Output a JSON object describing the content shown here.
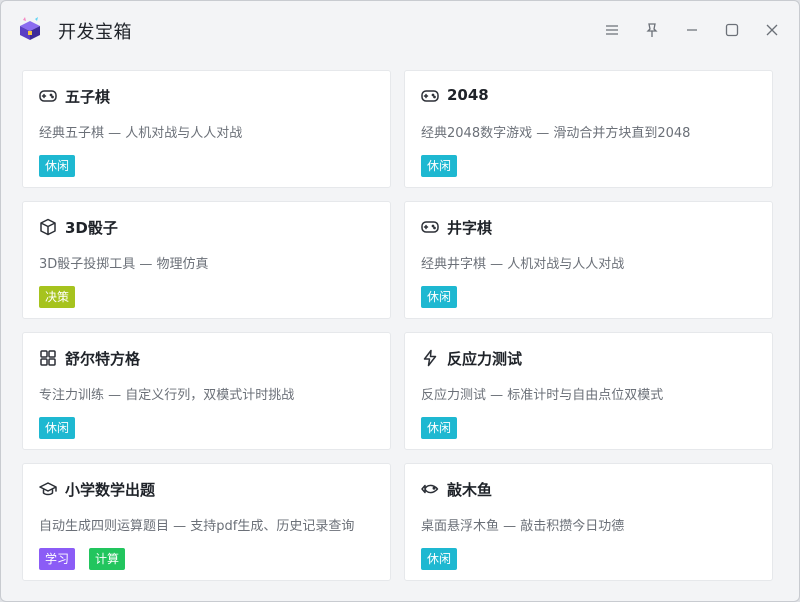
{
  "window": {
    "title": "开发宝箱",
    "logo": "treasure-chest-logo",
    "controls": [
      "menu-icon",
      "pin-icon",
      "minimize-icon",
      "maximize-icon",
      "close-icon"
    ]
  },
  "colors": {
    "tag_casual": "#1eb8d1",
    "tag_decision": "#a6c31e",
    "tag_study": "#8b5cf6",
    "tag_calc": "#22c55e"
  },
  "cards": [
    {
      "icon": "gamepad-icon",
      "title": "五子棋",
      "desc": "经典五子棋 — 人机对战与人人对战",
      "tags": [
        {
          "label": "休闲",
          "color": "#1eb8d1"
        }
      ]
    },
    {
      "icon": "gamepad-icon",
      "title": "2048",
      "desc": "经典2048数字游戏 — 滑动合并方块直到2048",
      "tags": [
        {
          "label": "休闲",
          "color": "#1eb8d1"
        }
      ]
    },
    {
      "icon": "cube-icon",
      "title": "3D骰子",
      "desc": "3D骰子投掷工具 — 物理仿真",
      "tags": [
        {
          "label": "决策",
          "color": "#a6c31e"
        }
      ]
    },
    {
      "icon": "gamepad-icon",
      "title": "井字棋",
      "desc": "经典井字棋 — 人机对战与人人对战",
      "tags": [
        {
          "label": "休闲",
          "color": "#1eb8d1"
        }
      ]
    },
    {
      "icon": "grid-icon",
      "title": "舒尔特方格",
      "desc": "专注力训练 — 自定义行列，双模式计时挑战",
      "tags": [
        {
          "label": "休闲",
          "color": "#1eb8d1"
        }
      ]
    },
    {
      "icon": "lightning-icon",
      "title": "反应力测试",
      "desc": "反应力测试 — 标准计时与自由点位双模式",
      "tags": [
        {
          "label": "休闲",
          "color": "#1eb8d1"
        }
      ]
    },
    {
      "icon": "graduation-cap-icon",
      "title": "小学数学出题",
      "desc": "自动生成四则运算题目 — 支持pdf生成、历史记录查询",
      "tags": [
        {
          "label": "学习",
          "color": "#8b5cf6"
        },
        {
          "label": "计算",
          "color": "#22c55e"
        }
      ]
    },
    {
      "icon": "fish-icon",
      "title": "敲木鱼",
      "desc": "桌面悬浮木鱼 — 敲击积攒今日功德",
      "tags": [
        {
          "label": "休闲",
          "color": "#1eb8d1"
        }
      ]
    }
  ]
}
